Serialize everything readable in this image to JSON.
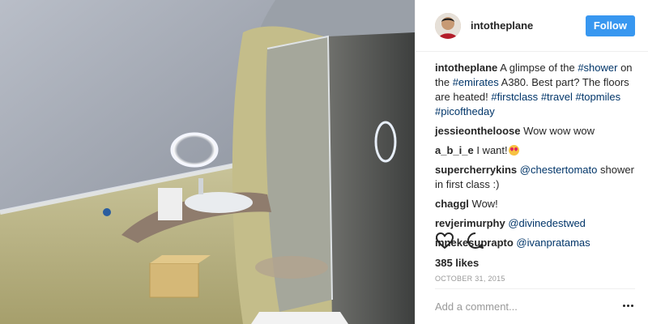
{
  "colors": {
    "accent": "#3897f0",
    "tag": "#003569",
    "muted": "#999999"
  },
  "header": {
    "username": "intotheplane",
    "follow_label": "Follow"
  },
  "caption": {
    "username": "intotheplane",
    "parts": [
      "A glimpse of the ",
      "#shower",
      " on the ",
      "#emirates",
      " A380. Best part? The floors are heated! ",
      "#firstclass",
      " ",
      "#travel",
      " ",
      "#topmiles",
      " ",
      "#picoftheday"
    ]
  },
  "comments": [
    {
      "username": "jessieontheloose",
      "text": "Wow wow wow"
    },
    {
      "username": "a_b_i_e",
      "text": "I want!",
      "emoji": "heart-eyes-emoji"
    },
    {
      "username": "supercherrykins",
      "mention": "@chestertomato",
      "text": " shower in first class :)"
    },
    {
      "username": "chaggl",
      "text": "Wow!"
    },
    {
      "username": "revjerimurphy",
      "mention": "@divinedestwed",
      "text": ""
    },
    {
      "username": "innekesuprapto",
      "mention": "@ivanpratamas",
      "text": ""
    }
  ],
  "actions": {
    "like_icon": "heart-icon",
    "comment_icon": "comment-icon"
  },
  "likes": "385 likes",
  "date": "OCTOBER 31, 2015",
  "add_comment": {
    "placeholder": "Add a comment...",
    "value": ""
  },
  "more_icon": "ellipsis-icon"
}
